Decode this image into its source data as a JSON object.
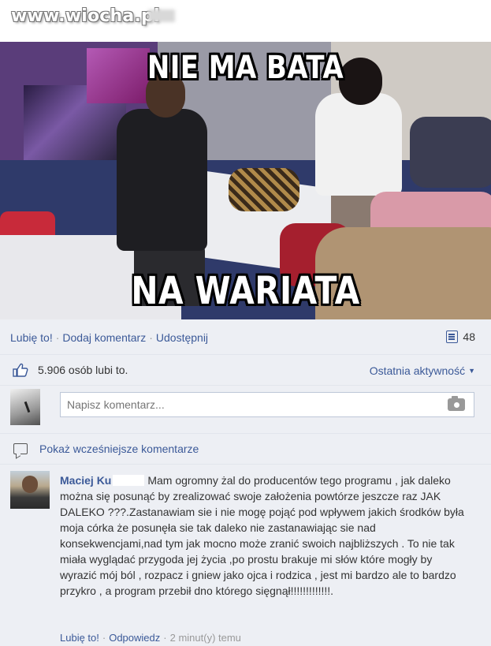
{
  "watermark": "www.wiocha.pl",
  "meme": {
    "top_text": "NIE MA BATA",
    "bottom_text": "NA WARIATA"
  },
  "actions": {
    "like": "Lubię to!",
    "comment": "Dodaj komentarz",
    "share": "Udostępnij",
    "share_count": "48"
  },
  "likes": {
    "text": "5.906 osób lubi to.",
    "activity": "Ostatnia aktywność"
  },
  "comment_box": {
    "placeholder": "Napisz komentarz..."
  },
  "previous_comments": "Pokaż wcześniejsze komentarze",
  "comment": {
    "author": "Maciej Ku",
    "text": "Mam ogromny żal do producentów tego programu , jak daleko można się posunąć by zrealizować swoje założenia powtórze jeszcze raz JAK DALEKO ???.Zastanawiam sie i nie mogę pojąć pod wpływem jakich środków była moja córka że posunęła sie tak daleko nie zastanawiając sie nad konsekwencjami,nad tym jak mocno może zranić swoich najbliższych . To nie tak miała wyglądać przygoda jej życia ,po prostu brakuje mi słów które mogły by wyrazić mój ból , rozpacz i gniew jako ojca i rodzica , jest mi bardzo ale to bardzo przykro , a program przebił dno którego sięgnął!!!!!!!!!!!!!.",
    "like": "Lubię to!",
    "reply": "Odpowiedz",
    "time": "2 minut(y) temu"
  },
  "colors": {
    "link": "#3b5998",
    "panel_bg": "#edeff4"
  }
}
